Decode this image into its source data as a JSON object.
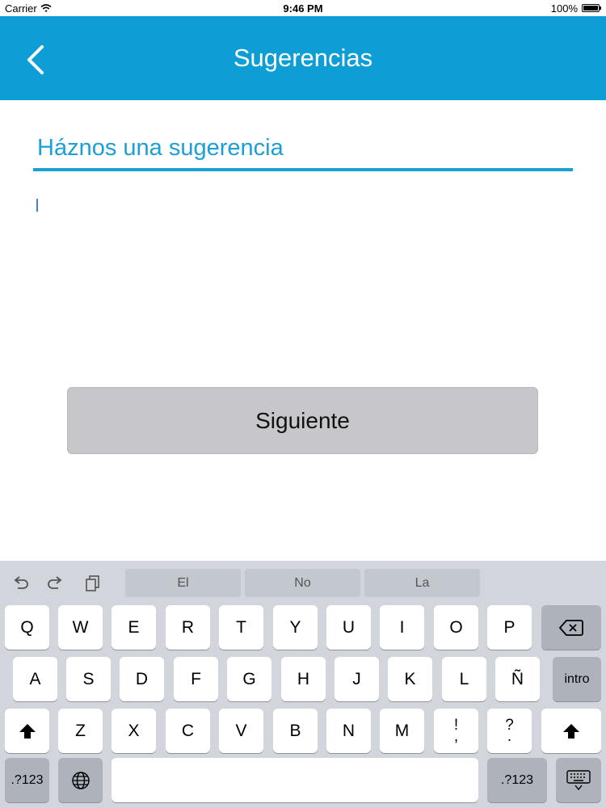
{
  "status_bar": {
    "carrier": "Carrier",
    "time": "9:46 PM",
    "battery": "100%"
  },
  "nav": {
    "title": "Sugerencias"
  },
  "form": {
    "heading": "Háznos una sugerencia",
    "text_value": ""
  },
  "next_button": {
    "label": "Siguiente"
  },
  "keyboard": {
    "suggestions": [
      "El",
      "No",
      "La"
    ],
    "row1": [
      "Q",
      "W",
      "E",
      "R",
      "T",
      "Y",
      "U",
      "I",
      "O",
      "P"
    ],
    "row2": [
      "A",
      "S",
      "D",
      "F",
      "G",
      "H",
      "J",
      "K",
      "L",
      "Ñ"
    ],
    "row3": [
      "Z",
      "X",
      "C",
      "V",
      "B",
      "N",
      "M"
    ],
    "return_label": "intro",
    "punct1_top": "!",
    "punct1_bottom": ",",
    "punct2_top": "?",
    "punct2_bottom": ".",
    "numbers_left": ".?123",
    "numbers_right": ".?123",
    "colors": {
      "accent": "#0d9ed5",
      "button_bg": "#c7c6cb",
      "keyboard_bg": "#d2d5db"
    }
  }
}
